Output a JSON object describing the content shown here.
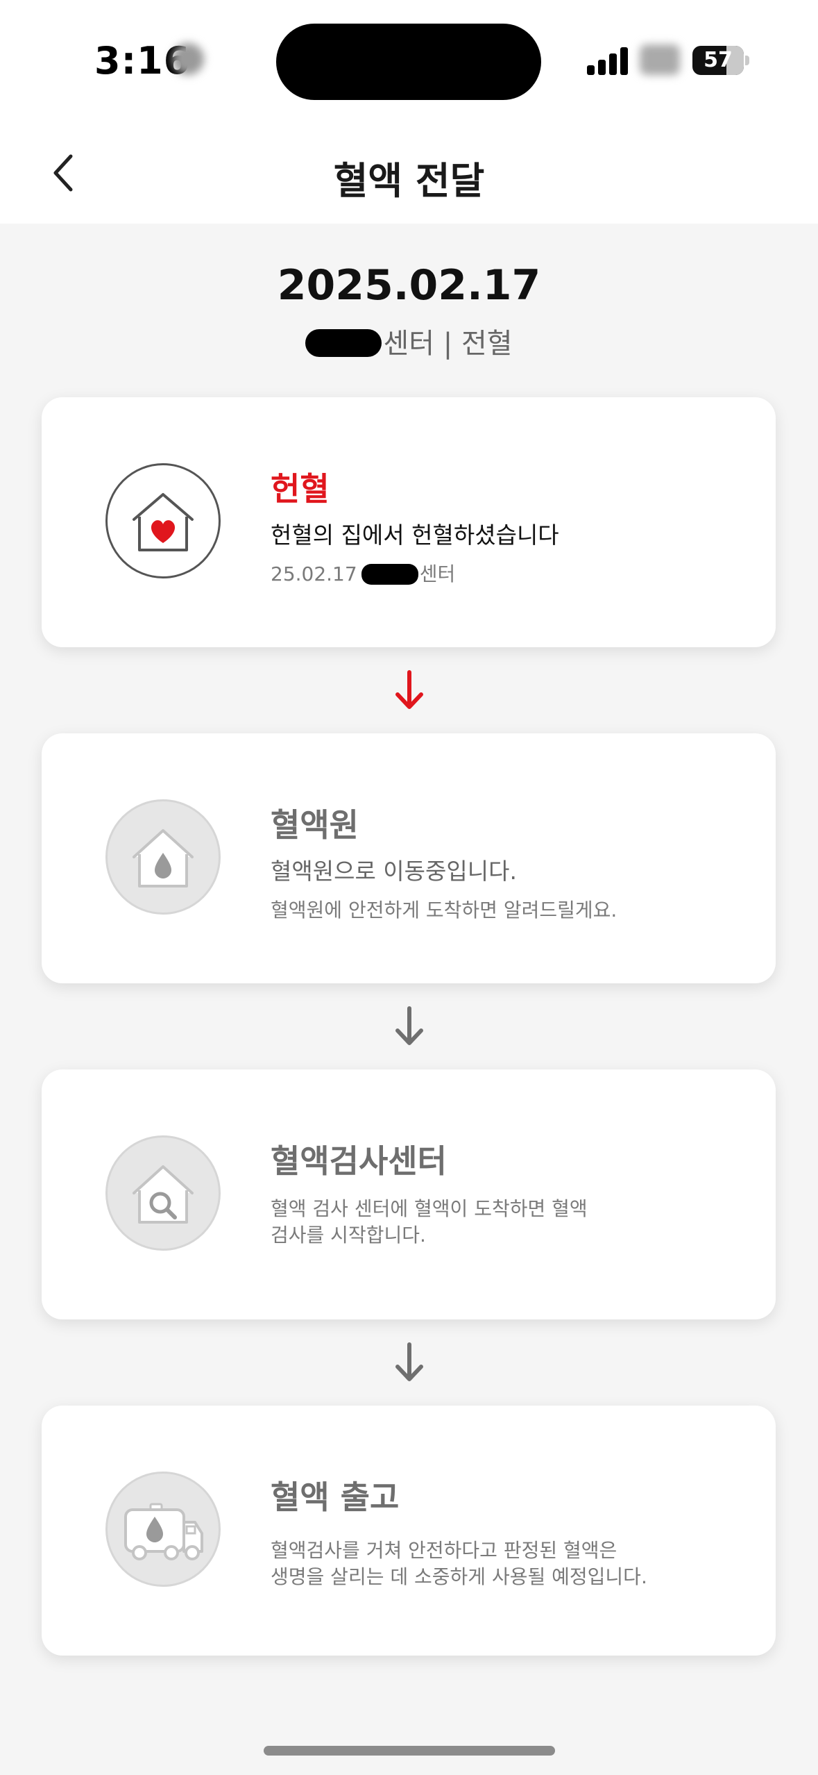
{
  "status_bar": {
    "time": "3:16",
    "battery_level": "57"
  },
  "header": {
    "title": "혈액 전달",
    "back_icon": "chevron-left-icon"
  },
  "summary": {
    "date": "2025.02.17",
    "place_suffix": "센터 | 전혈"
  },
  "steps": [
    {
      "state": "active",
      "icon": "house-heart-icon",
      "title": "헌혈",
      "description": "헌혈의 집에서 헌혈하셨습니다",
      "meta_date": "25.02.17",
      "meta_suffix": "센터"
    },
    {
      "state": "inactive",
      "icon": "house-drop-icon",
      "title": "혈액원",
      "description": "혈액원으로 이동중입니다.",
      "note": "혈액원에 안전하게 도착하면 알려드릴게요."
    },
    {
      "state": "inactive",
      "icon": "house-search-icon",
      "title": "혈액검사센터",
      "note_line1": "혈액 검사 센터에 혈액이 도착하면 혈액",
      "note_line2": "검사를 시작합니다."
    },
    {
      "state": "inactive",
      "icon": "truck-drop-icon",
      "title": "혈액 출고",
      "note_line1": "혈액검사를 거쳐 안전하다고 판정된 혈액은",
      "note_line2": "생명을 살리는 데 소중하게 사용될 예정입니다."
    }
  ],
  "colors": {
    "accent": "#e0161d",
    "inactive_arrow": "#6f6f6f",
    "background": "#f5f5f5"
  }
}
